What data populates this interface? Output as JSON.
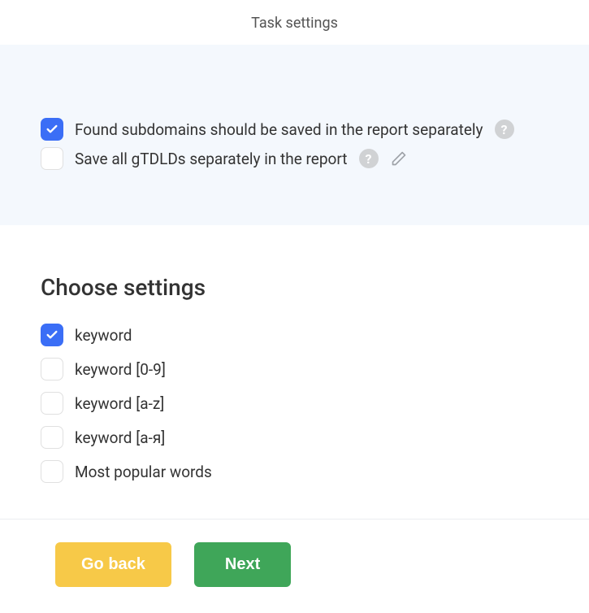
{
  "header": {
    "title": "Task settings"
  },
  "topOptions": [
    {
      "label": "Found subdomains should be saved in the report separately",
      "checked": true,
      "help": true,
      "pencil": false
    },
    {
      "label": "Save all gTDLDs separately in the report",
      "checked": false,
      "help": true,
      "pencil": true
    }
  ],
  "settings": {
    "title": "Choose settings",
    "items": [
      {
        "label": "keyword",
        "checked": true
      },
      {
        "label": "keyword [0-9]",
        "checked": false
      },
      {
        "label": "keyword [a-z]",
        "checked": false
      },
      {
        "label": "keyword [а-я]",
        "checked": false
      },
      {
        "label": "Most popular words",
        "checked": false
      }
    ]
  },
  "footer": {
    "back": "Go back",
    "next": "Next"
  },
  "icons": {
    "helpGlyph": "?"
  }
}
